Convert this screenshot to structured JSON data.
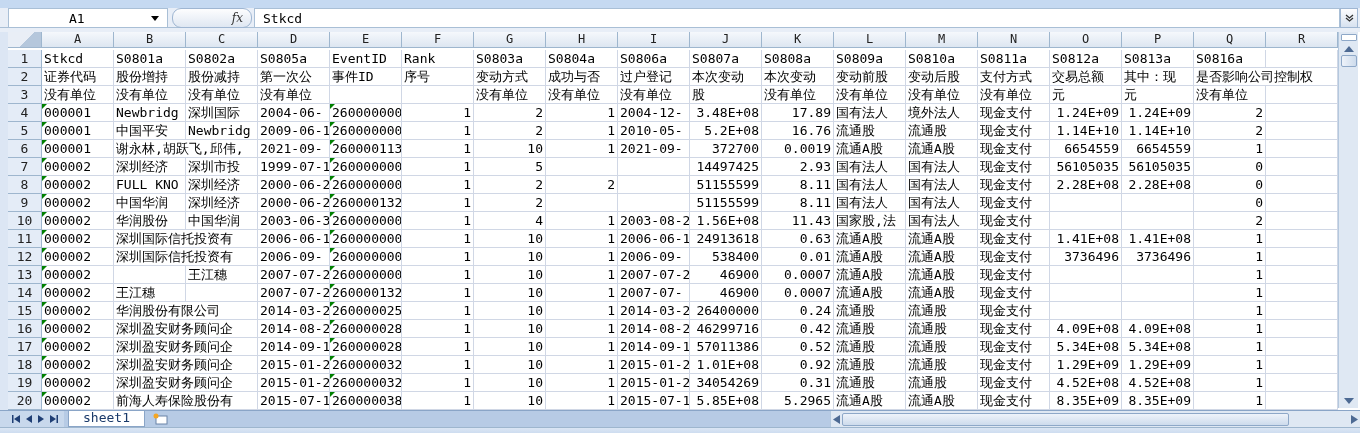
{
  "formula_bar": {
    "name_box": "A1",
    "function_button": "fx",
    "formula": "Stkcd"
  },
  "columns": [
    "A",
    "B",
    "C",
    "D",
    "E",
    "F",
    "G",
    "H",
    "I",
    "J",
    "K",
    "L",
    "M",
    "N",
    "O",
    "P",
    "Q",
    "R"
  ],
  "rows": [
    {
      "label": "1",
      "cells": [
        {
          "text": "Stkcd",
          "kind": "text"
        },
        {
          "text": "S0801a",
          "kind": "text"
        },
        {
          "text": "S0802a",
          "kind": "text"
        },
        {
          "text": "S0805a",
          "kind": "text"
        },
        {
          "text": "EventID",
          "kind": "text"
        },
        {
          "text": "Rank",
          "kind": "text"
        },
        {
          "text": "S0803a",
          "kind": "text"
        },
        {
          "text": "S0804a",
          "kind": "text"
        },
        {
          "text": "S0806a",
          "kind": "text"
        },
        {
          "text": "S0807a",
          "kind": "text"
        },
        {
          "text": "S0808a",
          "kind": "text"
        },
        {
          "text": "S0809a",
          "kind": "text"
        },
        {
          "text": "S0810a",
          "kind": "text"
        },
        {
          "text": "S0811a",
          "kind": "text"
        },
        {
          "text": "S0812a",
          "kind": "text"
        },
        {
          "text": "S0813a",
          "kind": "text"
        },
        {
          "text": "S0816a",
          "kind": "text"
        }
      ]
    },
    {
      "label": "2",
      "cells": [
        {
          "text": "证券代码",
          "kind": "text"
        },
        {
          "text": "股份增持",
          "kind": "text"
        },
        {
          "text": "股份减持",
          "kind": "text"
        },
        {
          "text": "第一次公",
          "kind": "text"
        },
        {
          "text": "事件ID",
          "kind": "text"
        },
        {
          "text": "序号",
          "kind": "text"
        },
        {
          "text": "变动方式",
          "kind": "text"
        },
        {
          "text": "成功与否",
          "kind": "text"
        },
        {
          "text": "过户登记",
          "kind": "text"
        },
        {
          "text": "本次变动",
          "kind": "text"
        },
        {
          "text": "本次变动",
          "kind": "text"
        },
        {
          "text": "变动前股",
          "kind": "text"
        },
        {
          "text": "变动后股",
          "kind": "text"
        },
        {
          "text": "支付方式",
          "kind": "text"
        },
        {
          "text": "交易总额",
          "kind": "text"
        },
        {
          "text": "其中：现",
          "kind": "text"
        },
        {
          "text": "是否影响公司控制权",
          "kind": "text"
        }
      ]
    },
    {
      "label": "3",
      "cells": [
        {
          "text": "没有单位",
          "kind": "text"
        },
        {
          "text": "没有单位",
          "kind": "text"
        },
        {
          "text": "没有单位",
          "kind": "text"
        },
        {
          "text": "没有单位",
          "kind": "text"
        },
        null,
        null,
        {
          "text": "没有单位",
          "kind": "text"
        },
        {
          "text": "没有单位",
          "kind": "text"
        },
        {
          "text": "没有单位",
          "kind": "text"
        },
        {
          "text": "股",
          "kind": "text"
        },
        {
          "text": "没有单位",
          "kind": "text"
        },
        {
          "text": "没有单位",
          "kind": "text"
        },
        {
          "text": "没有单位",
          "kind": "text"
        },
        {
          "text": "没有单位",
          "kind": "text"
        },
        {
          "text": "元",
          "kind": "text"
        },
        {
          "text": "元",
          "kind": "text"
        },
        {
          "text": "没有单位",
          "kind": "text"
        }
      ]
    },
    {
      "label": "4",
      "cells": [
        {
          "text": "000001",
          "kind": "flagged"
        },
        {
          "text": "Newbridg",
          "kind": "text"
        },
        {
          "text": "深圳国际",
          "kind": "text"
        },
        {
          "text": "2004-06-",
          "kind": "text"
        },
        {
          "text": "260000000",
          "kind": "flagged"
        },
        {
          "text": "1",
          "kind": "number"
        },
        {
          "text": "2",
          "kind": "number"
        },
        {
          "text": "1",
          "kind": "number"
        },
        {
          "text": "2004-12-",
          "kind": "text"
        },
        {
          "text": "3.48E+08",
          "kind": "number"
        },
        {
          "text": "17.89",
          "kind": "number"
        },
        {
          "text": "国有法人",
          "kind": "text"
        },
        {
          "text": "境外法人",
          "kind": "text"
        },
        {
          "text": "现金支付",
          "kind": "text"
        },
        {
          "text": "1.24E+09",
          "kind": "number"
        },
        {
          "text": "1.24E+09",
          "kind": "number"
        },
        {
          "text": "2",
          "kind": "number"
        }
      ]
    },
    {
      "label": "5",
      "cells": [
        {
          "text": "000001",
          "kind": "flagged"
        },
        {
          "text": "中国平安",
          "kind": "text"
        },
        {
          "text": "Newbridg",
          "kind": "text"
        },
        {
          "text": "2009-06-1",
          "kind": "text"
        },
        {
          "text": "260000000",
          "kind": "flagged"
        },
        {
          "text": "1",
          "kind": "number"
        },
        {
          "text": "2",
          "kind": "number"
        },
        {
          "text": "1",
          "kind": "number"
        },
        {
          "text": "2010-05-",
          "kind": "text"
        },
        {
          "text": "5.2E+08",
          "kind": "number"
        },
        {
          "text": "16.76",
          "kind": "number"
        },
        {
          "text": "流通股",
          "kind": "text"
        },
        {
          "text": "流通股",
          "kind": "text"
        },
        {
          "text": "现金支付",
          "kind": "text"
        },
        {
          "text": "1.14E+10",
          "kind": "number"
        },
        {
          "text": "1.14E+10",
          "kind": "number"
        },
        {
          "text": "2",
          "kind": "number"
        }
      ]
    },
    {
      "label": "6",
      "cells": [
        {
          "text": "000001",
          "kind": "flagged"
        },
        {
          "text": "谢永林,胡跃飞,邱伟,",
          "kind": "text"
        },
        null,
        {
          "text": "2021-09-",
          "kind": "text"
        },
        {
          "text": "260000113",
          "kind": "flagged"
        },
        {
          "text": "1",
          "kind": "number"
        },
        {
          "text": "10",
          "kind": "number"
        },
        {
          "text": "1",
          "kind": "number"
        },
        {
          "text": "2021-09-",
          "kind": "text"
        },
        {
          "text": "372700",
          "kind": "number"
        },
        {
          "text": "0.0019",
          "kind": "number"
        },
        {
          "text": "流通A股",
          "kind": "text"
        },
        {
          "text": "流通A股",
          "kind": "text"
        },
        {
          "text": "现金支付",
          "kind": "text"
        },
        {
          "text": "6654559",
          "kind": "number"
        },
        {
          "text": "6654559",
          "kind": "number"
        },
        {
          "text": "1",
          "kind": "number"
        }
      ]
    },
    {
      "label": "7",
      "cells": [
        {
          "text": "000002",
          "kind": "flagged"
        },
        {
          "text": "深圳经济",
          "kind": "text"
        },
        {
          "text": "深圳市投",
          "kind": "text"
        },
        {
          "text": "1999-07-1",
          "kind": "text"
        },
        {
          "text": "260000000",
          "kind": "flagged"
        },
        {
          "text": "1",
          "kind": "number"
        },
        {
          "text": "5",
          "kind": "number"
        },
        null,
        null,
        {
          "text": "14497425",
          "kind": "number"
        },
        {
          "text": "2.93",
          "kind": "number"
        },
        {
          "text": "国有法人",
          "kind": "text"
        },
        {
          "text": "国有法人",
          "kind": "text"
        },
        {
          "text": "现金支付",
          "kind": "text"
        },
        {
          "text": "56105035",
          "kind": "number"
        },
        {
          "text": "56105035",
          "kind": "number"
        },
        {
          "text": "0",
          "kind": "number"
        }
      ]
    },
    {
      "label": "8",
      "cells": [
        {
          "text": "000002",
          "kind": "flagged"
        },
        {
          "text": "FULL KNO",
          "kind": "text"
        },
        {
          "text": "深圳经济",
          "kind": "text"
        },
        {
          "text": "2000-06-2",
          "kind": "text"
        },
        {
          "text": "260000000",
          "kind": "flagged"
        },
        {
          "text": "1",
          "kind": "number"
        },
        {
          "text": "2",
          "kind": "number"
        },
        {
          "text": "2",
          "kind": "number"
        },
        null,
        {
          "text": "51155599",
          "kind": "number"
        },
        {
          "text": "8.11",
          "kind": "number"
        },
        {
          "text": "国有法人",
          "kind": "text"
        },
        {
          "text": "国有法人",
          "kind": "text"
        },
        {
          "text": "现金支付",
          "kind": "text"
        },
        {
          "text": "2.28E+08",
          "kind": "number"
        },
        {
          "text": "2.28E+08",
          "kind": "number"
        },
        {
          "text": "0",
          "kind": "number"
        }
      ]
    },
    {
      "label": "9",
      "cells": [
        {
          "text": "000002",
          "kind": "flagged"
        },
        {
          "text": "中国华润",
          "kind": "text"
        },
        {
          "text": "深圳经济",
          "kind": "text"
        },
        {
          "text": "2000-06-2",
          "kind": "text"
        },
        {
          "text": "260000132",
          "kind": "flagged"
        },
        {
          "text": "1",
          "kind": "number"
        },
        {
          "text": "2",
          "kind": "number"
        },
        null,
        null,
        {
          "text": "51155599",
          "kind": "number"
        },
        {
          "text": "8.11",
          "kind": "number"
        },
        {
          "text": "国有法人",
          "kind": "text"
        },
        {
          "text": "国有法人",
          "kind": "text"
        },
        {
          "text": "现金支付",
          "kind": "text"
        },
        null,
        null,
        {
          "text": "0",
          "kind": "number"
        }
      ]
    },
    {
      "label": "10",
      "cells": [
        {
          "text": "000002",
          "kind": "flagged"
        },
        {
          "text": "华润股份",
          "kind": "text"
        },
        {
          "text": "中国华润",
          "kind": "text"
        },
        {
          "text": "2003-06-3",
          "kind": "text"
        },
        {
          "text": "260000000",
          "kind": "flagged"
        },
        {
          "text": "1",
          "kind": "number"
        },
        {
          "text": "4",
          "kind": "number"
        },
        {
          "text": "1",
          "kind": "number"
        },
        {
          "text": "2003-08-2",
          "kind": "text"
        },
        {
          "text": "1.56E+08",
          "kind": "number"
        },
        {
          "text": "11.43",
          "kind": "number"
        },
        {
          "text": "国家股,法",
          "kind": "text"
        },
        {
          "text": "国有法人",
          "kind": "text"
        },
        {
          "text": "现金支付",
          "kind": "text"
        },
        null,
        null,
        {
          "text": "2",
          "kind": "number"
        }
      ]
    },
    {
      "label": "11",
      "cells": [
        {
          "text": "000002",
          "kind": "flagged"
        },
        {
          "text": "深圳国际信托投资有",
          "kind": "text"
        },
        null,
        {
          "text": "2006-06-1",
          "kind": "text"
        },
        {
          "text": "260000000",
          "kind": "flagged"
        },
        {
          "text": "1",
          "kind": "number"
        },
        {
          "text": "10",
          "kind": "number"
        },
        {
          "text": "1",
          "kind": "number"
        },
        {
          "text": "2006-06-1",
          "kind": "text"
        },
        {
          "text": "24913618",
          "kind": "number"
        },
        {
          "text": "0.63",
          "kind": "number"
        },
        {
          "text": "流通A股",
          "kind": "text"
        },
        {
          "text": "流通A股",
          "kind": "text"
        },
        {
          "text": "现金支付",
          "kind": "text"
        },
        {
          "text": "1.41E+08",
          "kind": "number"
        },
        {
          "text": "1.41E+08",
          "kind": "number"
        },
        {
          "text": "1",
          "kind": "number"
        }
      ]
    },
    {
      "label": "12",
      "cells": [
        {
          "text": "000002",
          "kind": "flagged"
        },
        {
          "text": "深圳国际信托投资有",
          "kind": "text"
        },
        null,
        {
          "text": "2006-09-",
          "kind": "text"
        },
        {
          "text": "260000000",
          "kind": "flagged"
        },
        {
          "text": "1",
          "kind": "number"
        },
        {
          "text": "10",
          "kind": "number"
        },
        {
          "text": "1",
          "kind": "number"
        },
        {
          "text": "2006-09-",
          "kind": "text"
        },
        {
          "text": "538400",
          "kind": "number"
        },
        {
          "text": "0.01",
          "kind": "number"
        },
        {
          "text": "流通A股",
          "kind": "text"
        },
        {
          "text": "流通A股",
          "kind": "text"
        },
        {
          "text": "现金支付",
          "kind": "text"
        },
        {
          "text": "3736496",
          "kind": "number"
        },
        {
          "text": "3736496",
          "kind": "number"
        },
        {
          "text": "1",
          "kind": "number"
        }
      ]
    },
    {
      "label": "13",
      "cells": [
        {
          "text": "000002",
          "kind": "flagged"
        },
        null,
        {
          "text": "王江穗",
          "kind": "text"
        },
        {
          "text": "2007-07-2",
          "kind": "text"
        },
        {
          "text": "260000000",
          "kind": "flagged"
        },
        {
          "text": "1",
          "kind": "number"
        },
        {
          "text": "10",
          "kind": "number"
        },
        {
          "text": "1",
          "kind": "number"
        },
        {
          "text": "2007-07-2",
          "kind": "text"
        },
        {
          "text": "46900",
          "kind": "number"
        },
        {
          "text": "0.0007",
          "kind": "number"
        },
        {
          "text": "流通A股",
          "kind": "text"
        },
        {
          "text": "流通A股",
          "kind": "text"
        },
        {
          "text": "现金支付",
          "kind": "text"
        },
        null,
        null,
        {
          "text": "1",
          "kind": "number"
        }
      ]
    },
    {
      "label": "14",
      "cells": [
        {
          "text": "000002",
          "kind": "flagged"
        },
        {
          "text": "王江穗",
          "kind": "text"
        },
        null,
        {
          "text": "2007-07-2",
          "kind": "text"
        },
        {
          "text": "260000132",
          "kind": "flagged"
        },
        {
          "text": "1",
          "kind": "number"
        },
        {
          "text": "10",
          "kind": "number"
        },
        {
          "text": "1",
          "kind": "number"
        },
        {
          "text": "2007-07-",
          "kind": "text"
        },
        {
          "text": "46900",
          "kind": "number"
        },
        {
          "text": "0.0007",
          "kind": "number"
        },
        {
          "text": "流通A股",
          "kind": "text"
        },
        {
          "text": "流通A股",
          "kind": "text"
        },
        {
          "text": "现金支付",
          "kind": "text"
        },
        null,
        null,
        {
          "text": "1",
          "kind": "number"
        }
      ]
    },
    {
      "label": "15",
      "cells": [
        {
          "text": "000002",
          "kind": "flagged"
        },
        {
          "text": "华润股份有限公司",
          "kind": "text"
        },
        null,
        {
          "text": "2014-03-2",
          "kind": "text"
        },
        {
          "text": "260000025",
          "kind": "flagged"
        },
        {
          "text": "1",
          "kind": "number"
        },
        {
          "text": "10",
          "kind": "number"
        },
        {
          "text": "1",
          "kind": "number"
        },
        {
          "text": "2014-03-2",
          "kind": "text"
        },
        {
          "text": "26400000",
          "kind": "number"
        },
        {
          "text": "0.24",
          "kind": "number"
        },
        {
          "text": "流通股",
          "kind": "text"
        },
        {
          "text": "流通股",
          "kind": "text"
        },
        {
          "text": "现金支付",
          "kind": "text"
        },
        null,
        null,
        {
          "text": "1",
          "kind": "number"
        }
      ]
    },
    {
      "label": "16",
      "cells": [
        {
          "text": "000002",
          "kind": "flagged"
        },
        {
          "text": "深圳盈安财务顾问企",
          "kind": "text"
        },
        null,
        {
          "text": "2014-08-2",
          "kind": "text"
        },
        {
          "text": "260000028",
          "kind": "flagged"
        },
        {
          "text": "1",
          "kind": "number"
        },
        {
          "text": "10",
          "kind": "number"
        },
        {
          "text": "1",
          "kind": "number"
        },
        {
          "text": "2014-08-2",
          "kind": "text"
        },
        {
          "text": "46299716",
          "kind": "number"
        },
        {
          "text": "0.42",
          "kind": "number"
        },
        {
          "text": "流通股",
          "kind": "text"
        },
        {
          "text": "流通股",
          "kind": "text"
        },
        {
          "text": "现金支付",
          "kind": "text"
        },
        {
          "text": "4.09E+08",
          "kind": "number"
        },
        {
          "text": "4.09E+08",
          "kind": "number"
        },
        {
          "text": "1",
          "kind": "number"
        }
      ]
    },
    {
      "label": "17",
      "cells": [
        {
          "text": "000002",
          "kind": "flagged"
        },
        {
          "text": "深圳盈安财务顾问企",
          "kind": "text"
        },
        null,
        {
          "text": "2014-09-1",
          "kind": "text"
        },
        {
          "text": "260000028",
          "kind": "flagged"
        },
        {
          "text": "1",
          "kind": "number"
        },
        {
          "text": "10",
          "kind": "number"
        },
        {
          "text": "1",
          "kind": "number"
        },
        {
          "text": "2014-09-1",
          "kind": "text"
        },
        {
          "text": "57011386",
          "kind": "number"
        },
        {
          "text": "0.52",
          "kind": "number"
        },
        {
          "text": "流通股",
          "kind": "text"
        },
        {
          "text": "流通股",
          "kind": "text"
        },
        {
          "text": "现金支付",
          "kind": "text"
        },
        {
          "text": "5.34E+08",
          "kind": "number"
        },
        {
          "text": "5.34E+08",
          "kind": "number"
        },
        {
          "text": "1",
          "kind": "number"
        }
      ]
    },
    {
      "label": "18",
      "cells": [
        {
          "text": "000002",
          "kind": "flagged"
        },
        {
          "text": "深圳盈安财务顾问企",
          "kind": "text"
        },
        null,
        {
          "text": "2015-01-2",
          "kind": "text"
        },
        {
          "text": "260000032",
          "kind": "flagged"
        },
        {
          "text": "1",
          "kind": "number"
        },
        {
          "text": "10",
          "kind": "number"
        },
        {
          "text": "1",
          "kind": "number"
        },
        {
          "text": "2015-01-2",
          "kind": "text"
        },
        {
          "text": "1.01E+08",
          "kind": "number"
        },
        {
          "text": "0.92",
          "kind": "number"
        },
        {
          "text": "流通股",
          "kind": "text"
        },
        {
          "text": "流通股",
          "kind": "text"
        },
        {
          "text": "现金支付",
          "kind": "text"
        },
        {
          "text": "1.29E+09",
          "kind": "number"
        },
        {
          "text": "1.29E+09",
          "kind": "number"
        },
        {
          "text": "1",
          "kind": "number"
        }
      ]
    },
    {
      "label": "19",
      "cells": [
        {
          "text": "000002",
          "kind": "flagged"
        },
        {
          "text": "深圳盈安财务顾问企",
          "kind": "text"
        },
        null,
        {
          "text": "2015-01-2",
          "kind": "text"
        },
        {
          "text": "260000032",
          "kind": "flagged"
        },
        {
          "text": "1",
          "kind": "number"
        },
        {
          "text": "10",
          "kind": "number"
        },
        {
          "text": "1",
          "kind": "number"
        },
        {
          "text": "2015-01-2",
          "kind": "text"
        },
        {
          "text": "34054269",
          "kind": "number"
        },
        {
          "text": "0.31",
          "kind": "number"
        },
        {
          "text": "流通股",
          "kind": "text"
        },
        {
          "text": "流通股",
          "kind": "text"
        },
        {
          "text": "现金支付",
          "kind": "text"
        },
        {
          "text": "4.52E+08",
          "kind": "number"
        },
        {
          "text": "4.52E+08",
          "kind": "number"
        },
        {
          "text": "1",
          "kind": "number"
        }
      ]
    },
    {
      "label": "20",
      "cells": [
        {
          "text": "000002",
          "kind": "flagged"
        },
        {
          "text": "前海人寿保险股份有",
          "kind": "text"
        },
        null,
        {
          "text": "2015-07-1",
          "kind": "text"
        },
        {
          "text": "260000038",
          "kind": "flagged"
        },
        {
          "text": "1",
          "kind": "number"
        },
        {
          "text": "10",
          "kind": "number"
        },
        {
          "text": "1",
          "kind": "number"
        },
        {
          "text": "2015-07-1",
          "kind": "text"
        },
        {
          "text": "5.85E+08",
          "kind": "number"
        },
        {
          "text": "5.2965",
          "kind": "number"
        },
        {
          "text": "流通A股",
          "kind": "text"
        },
        {
          "text": "流通A股",
          "kind": "text"
        },
        {
          "text": "现金支付",
          "kind": "text"
        },
        {
          "text": "8.35E+09",
          "kind": "number"
        },
        {
          "text": "8.35E+09",
          "kind": "number"
        },
        {
          "text": "1",
          "kind": "number"
        }
      ]
    }
  ],
  "sheet_tabs": [
    {
      "label": "sheet1",
      "selected": true
    }
  ]
}
